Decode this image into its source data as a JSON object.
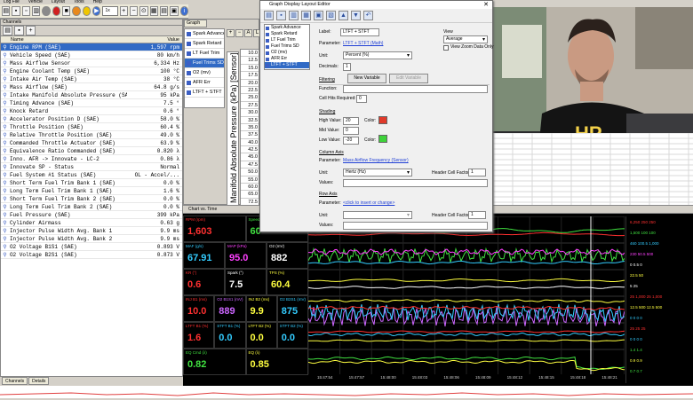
{
  "menubar": [
    "Log File",
    "Vehicle",
    "Layout",
    "Tools",
    "Help"
  ],
  "toolbar": {
    "zoom": "1x"
  },
  "channels": {
    "title": "Channels",
    "col_name": "Name",
    "col_value": "Value",
    "rows": [
      {
        "name": "Engine RPM (SAE)",
        "value": "1,597 rpm",
        "selected": true
      },
      {
        "name": "Vehicle Speed (SAE)",
        "value": "80 km/h"
      },
      {
        "name": "Mass Airflow Sensor",
        "value": "6,334 Hz"
      },
      {
        "name": "Engine Coolant Temp (SAE)",
        "value": "100 °C"
      },
      {
        "name": "Intake Air Temp (SAE)",
        "value": "38 °C"
      },
      {
        "name": "Mass Airflow (SAE)",
        "value": "64.8 g/s"
      },
      {
        "name": "Intake Manifold Absolute Pressure (SAE)",
        "value": "95 kPa"
      },
      {
        "name": "Timing Advance (SAE)",
        "value": "7.5 °"
      },
      {
        "name": "Knock Retard",
        "value": "0.6 °"
      },
      {
        "name": "Accelerator Position D (SAE)",
        "value": "58.0 %"
      },
      {
        "name": "Throttle Position (SAE)",
        "value": "60.4 %"
      },
      {
        "name": "Relative Throttle Position (SAE)",
        "value": "49.0 %"
      },
      {
        "name": "Commanded Throttle Actuator (SAE)",
        "value": "63.9 %"
      },
      {
        "name": "Equivalence Ratio Commanded (SAE)",
        "value": "0.820 λ"
      },
      {
        "name": "Inno. AFR -> Innovate - LC-2",
        "value": "0.86 λ"
      },
      {
        "name": "Innovate SP - Status",
        "value": "Normal"
      },
      {
        "name": "Fuel System #1 Status (SAE)",
        "value": "OL - Accel/..."
      },
      {
        "name": "Short Term Fuel Trim Bank 1 (SAE)",
        "value": "0.0 %"
      },
      {
        "name": "Long Term Fuel Trim Bank 1 (SAE)",
        "value": "1.6 %"
      },
      {
        "name": "Short Term Fuel Trim Bank 2 (SAE)",
        "value": "0.0 %"
      },
      {
        "name": "Long Term Fuel Trim Bank 2 (SAE)",
        "value": "0.0 %"
      },
      {
        "name": "Fuel Pressure (SAE)",
        "value": "399 kPa"
      },
      {
        "name": "Cylinder Airmass",
        "value": "0.63 g"
      },
      {
        "name": "Injector Pulse Width Avg. Bank 1",
        "value": "9.9 ms"
      },
      {
        "name": "Injector Pulse Width Avg. Bank 2",
        "value": "9.9 ms"
      },
      {
        "name": "O2 Voltage B1S1 (SAE)",
        "value": "0.893 V"
      },
      {
        "name": "O2 Voltage B2S1 (SAE)",
        "value": "0.873 V"
      }
    ],
    "tabs": [
      "Channels",
      "Details"
    ]
  },
  "graph": {
    "tab": "Graph",
    "items": [
      "Spark Advance",
      "Spark Retard",
      "LT Fuel Trim",
      "Fuel Trims SD",
      "O2 (mv)",
      "AFR Err",
      "LTFT + STFT"
    ],
    "selected_index": 3,
    "axis_label": "Manifold Absolute Pressure (kPa) [Sensor]",
    "axis_values": [
      "10.0",
      "12.5",
      "15.0",
      "17.5",
      "20.0",
      "22.5",
      "25.0",
      "27.5",
      "30.0",
      "32.5",
      "35.0",
      "37.5",
      "40.0",
      "42.5",
      "45.0",
      "47.5",
      "50.0",
      "55.0",
      "60.0",
      "65.0",
      "72.5"
    ],
    "buttons": [
      "+",
      "−",
      "A",
      "L"
    ]
  },
  "editor": {
    "title": "Graph Display Layout Editor",
    "list": [
      "Spark Advance",
      "Spark Retard",
      "LT Fuel Trim",
      "Fuel Trims SD",
      "O2 (mv)",
      "AFR Err",
      "LTFT + STFT"
    ],
    "list_selected": 6,
    "label_caption": "Label:",
    "label_value": "LTFT + STFT",
    "parameter_caption": "Parameter:",
    "parameter_value": "LTFT + STFT (Math)",
    "unit_caption": "Unit:",
    "unit_value": "Percent (%)",
    "decimals_caption": "Decimals:",
    "decimals_value": "1",
    "new_variable": "New Variable",
    "edit_variable": "Edit Variable",
    "view_caption": "View",
    "view_value": "Average",
    "view_zoom": "View Zoom Data Only",
    "filtering_caption": "Filtering",
    "function_caption": "Function:",
    "cell_hits_caption": "Cell Hits Required:",
    "cell_hits_value": "0",
    "shading_caption": "Shading",
    "high_caption": "High Value:",
    "high_value": "20",
    "mid_caption": "Mid Value:",
    "mid_value": "0",
    "low_caption": "Low Value:",
    "low_value": "-20",
    "color_caption": "Color:",
    "column_axis_caption": "Column Axis",
    "col_param_value": "Mass Airflow Frequency (Sensor)",
    "col_unit_value": "Hertz (Hz)",
    "header_factor_caption": "Header Cell Factor:",
    "header_factor_value": "1",
    "values_caption": "Values:",
    "row_axis_caption": "Row Axis",
    "row_param_value": "<click to insert or change>",
    "row_header_factor_value": "1",
    "colors": {
      "high": "#e03a2a",
      "low": "#3ed23a"
    }
  },
  "chart": {
    "tab": "Chart vs. Time",
    "gauges": [
      {
        "label": "RPM (rpm)",
        "value": "1,603",
        "color": "#ff3030"
      },
      {
        "label": "Speed (km/h)",
        "value": "60",
        "color": "#40e040"
      },
      {
        "label": "MAF (g/s)",
        "value": "67.91",
        "color": "#33ccff"
      },
      {
        "label": "MAP (kPa)",
        "value": "95.0",
        "color": "#ff40ff"
      },
      {
        "label": "O2 (mV)",
        "value": "882",
        "color": "#ffffff"
      },
      {
        "label": "KR (°)",
        "value": "0.6",
        "color": "#ff3030"
      },
      {
        "label": "Spark (°)",
        "value": "7.5",
        "color": "#ffffff"
      },
      {
        "label": "TPS (%)",
        "value": "60.4",
        "color": "#ffff40"
      },
      {
        "label": "INJ B1 (ms)",
        "value": "10.0",
        "color": "#ff3030"
      },
      {
        "label": "O2 B1S1 (mV)",
        "value": "889",
        "color": "#cc66ff"
      },
      {
        "label": "INJ B2 (ms)",
        "value": "9.9",
        "color": "#ffff40"
      },
      {
        "label": "O2 B2S1 (mV)",
        "value": "875",
        "color": "#33ccff"
      },
      {
        "label": "LTFT B1 (%)",
        "value": "1.6",
        "color": "#ff3030"
      },
      {
        "label": "STFT B1 (%)",
        "value": "0.0",
        "color": "#33ccff"
      },
      {
        "label": "LTFT B2 (%)",
        "value": "0.0",
        "color": "#ffff40"
      },
      {
        "label": "STFT B2 (%)",
        "value": "0.0",
        "color": "#33ccff"
      },
      {
        "label": "EQ Cmd (λ)",
        "value": "0.82",
        "color": "#40e040"
      },
      {
        "label": "EQ (λ)",
        "value": "0.85",
        "color": "#ffff40"
      }
    ],
    "times": [
      "15:47:54",
      "15:47:57",
      "15:48:00",
      "15:48:03",
      "15:48:06",
      "15:48:09",
      "15:48:12",
      "15:48:15",
      "15:48:18",
      "15:48:21"
    ],
    "right_scale": [
      {
        "text": "6,250 250 250",
        "color": "#ff3030"
      },
      {
        "text": "1,500 100 100",
        "color": "#40e040"
      },
      {
        "text": "460 100.5 1,000",
        "color": "#33ccff"
      },
      {
        "text": "230 50.5 500",
        "color": "#ff40ff"
      },
      {
        "text": "0 0.5 0",
        "color": "#ffffff"
      },
      {
        "text": "22.5 50",
        "color": "#ffff40"
      },
      {
        "text": "5 25",
        "color": "#ffffff"
      },
      {
        "text": "25 1,000 25 1,000",
        "color": "#ff3030"
      },
      {
        "text": "12.5 500 12.5 500",
        "color": "#ffff40"
      },
      {
        "text": "0 0 0 0",
        "color": "#33ccff"
      },
      {
        "text": "25 25 25",
        "color": "#ff3030"
      },
      {
        "text": "0 0 0 0",
        "color": "#33ccff"
      },
      {
        "text": "1.4 1.4",
        "color": "#40e040"
      },
      {
        "text": "0.9 0.9",
        "color": "#ffff40"
      },
      {
        "text": "0.7 0.7",
        "color": "#40e040"
      }
    ]
  }
}
